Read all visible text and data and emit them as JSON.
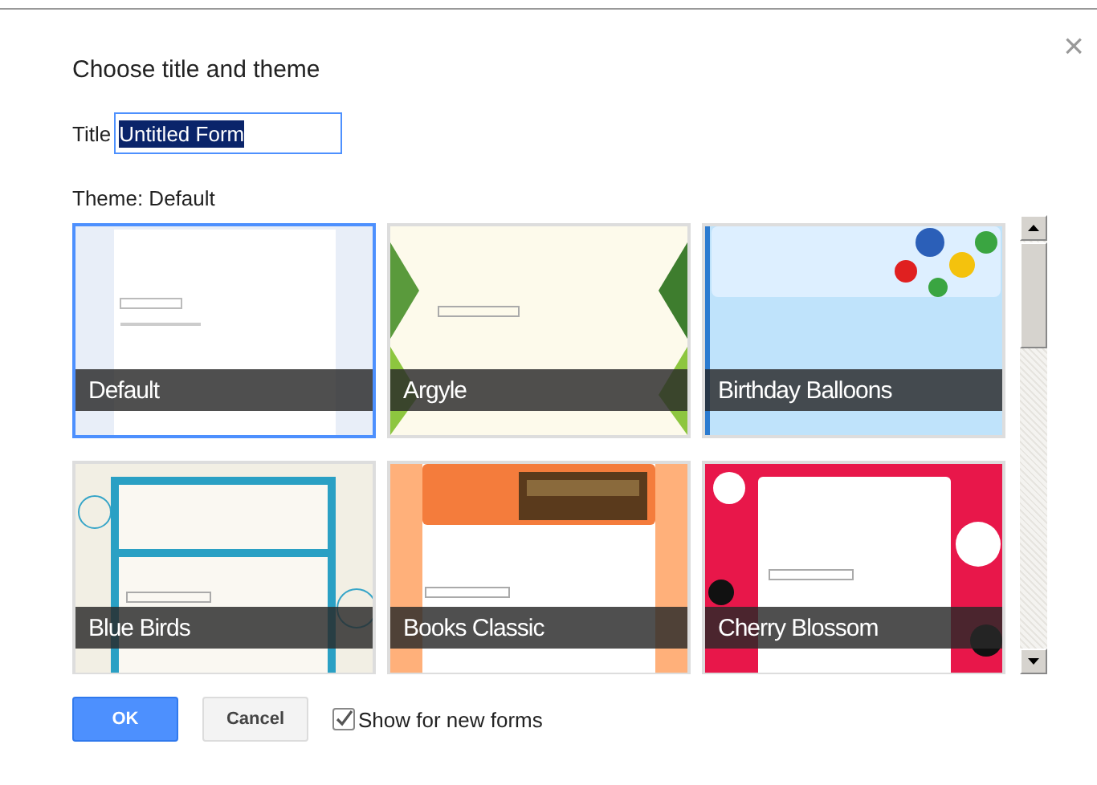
{
  "dialog": {
    "title": "Choose title and theme",
    "close": "×"
  },
  "title_field": {
    "label": "Title",
    "value": "Untitled Form"
  },
  "theme_label": "Theme: Default",
  "themes": [
    {
      "name": "Default",
      "selected": true
    },
    {
      "name": "Argyle",
      "selected": false
    },
    {
      "name": "Birthday Balloons",
      "selected": false
    },
    {
      "name": "Blue Birds",
      "selected": false
    },
    {
      "name": "Books Classic",
      "selected": false
    },
    {
      "name": "Cherry Blossom",
      "selected": false
    }
  ],
  "buttons": {
    "ok": "OK",
    "cancel": "Cancel"
  },
  "show_for_new": {
    "label": "Show for new forms",
    "checked": true
  }
}
